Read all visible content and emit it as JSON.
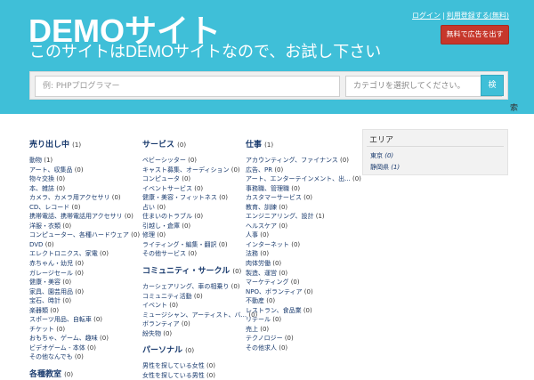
{
  "header": {
    "title": "DEMOサイト",
    "subtitle": "このサイトはDEMOサイトなので、お試し下さい",
    "login_label": "ログイン",
    "register_label": "利用登録する(無料)",
    "separator": "|",
    "ad_button_label": "無料で広告を出す"
  },
  "search": {
    "placeholder": "例: PHPプログラマー",
    "category_placeholder": "カテゴリを選択してください。",
    "button_label": "検"
  },
  "below_glyph": "索",
  "columns": [
    {
      "groups": [
        {
          "title": "売り出し中",
          "count": "(1)",
          "items": [
            {
              "label": "動物",
              "count": "(1)"
            },
            {
              "label": "アート、収集品",
              "count": "(0)"
            },
            {
              "label": "物々交換",
              "count": "(0)"
            },
            {
              "label": "本、雑誌",
              "count": "(0)"
            },
            {
              "label": "カメラ、カメラ用アクセサリ",
              "count": "(0)"
            },
            {
              "label": "CD、レコード",
              "count": "(0)"
            },
            {
              "label": "携帯電話、携帯電話用アクセサリ",
              "count": "(0)"
            },
            {
              "label": "洋服・衣類",
              "count": "(0)"
            },
            {
              "label": "コンピューター、各種ハードウェア",
              "count": "(0)"
            },
            {
              "label": "DVD",
              "count": "(0)"
            },
            {
              "label": "エレクトロニクス、家電",
              "count": "(0)"
            },
            {
              "label": "赤ちゃん・幼児",
              "count": "(0)"
            },
            {
              "label": "ガレージセール",
              "count": "(0)"
            },
            {
              "label": "健康・美容",
              "count": "(0)"
            },
            {
              "label": "家具、園芸用品",
              "count": "(0)"
            },
            {
              "label": "宝石、時計",
              "count": "(0)"
            },
            {
              "label": "楽器類",
              "count": "(0)"
            },
            {
              "label": "スポーツ用品、自転車",
              "count": "(0)"
            },
            {
              "label": "チケット",
              "count": "(0)"
            },
            {
              "label": "おもちゃ、ゲーム、趣味",
              "count": "(0)"
            },
            {
              "label": "ビデオゲーム - 本体",
              "count": "(0)"
            },
            {
              "label": "その他なんでも",
              "count": "(0)"
            }
          ]
        },
        {
          "title": "各種教室",
          "count": "(0)",
          "items": []
        }
      ]
    },
    {
      "groups": [
        {
          "title": "サービス",
          "count": "(0)",
          "items": [
            {
              "label": "ベビーシッター",
              "count": "(0)"
            },
            {
              "label": "キャスト募集、オーディション",
              "count": "(0)"
            },
            {
              "label": "コンピュータ",
              "count": "(0)"
            },
            {
              "label": "イベントサービス",
              "count": "(0)"
            },
            {
              "label": "健康・美容・フィットネス",
              "count": "(0)"
            },
            {
              "label": "占い",
              "count": "(0)"
            },
            {
              "label": "住まいのトラブル",
              "count": "(0)"
            },
            {
              "label": "引越し・倉庫",
              "count": "(0)"
            },
            {
              "label": "修理",
              "count": "(0)"
            },
            {
              "label": "ライティング・編集・翻訳",
              "count": "(0)"
            },
            {
              "label": "その他サービス",
              "count": "(0)"
            }
          ]
        },
        {
          "title": "コミュニティ・サークル",
          "count": "(0)",
          "items": [
            {
              "label": "カーシェアリング、車の相乗り",
              "count": "(0)"
            },
            {
              "label": "コミュニティ活動",
              "count": "(0)"
            },
            {
              "label": "イベント",
              "count": "(0)"
            },
            {
              "label": "ミュージシャン、アーティスト、バ...",
              "count": "(0)"
            },
            {
              "label": "ボランティア",
              "count": "(0)"
            },
            {
              "label": "紛失物",
              "count": "(0)"
            }
          ]
        },
        {
          "title": "パーソナル",
          "count": "(0)",
          "items": [
            {
              "label": "男性を探している女性",
              "count": "(0)"
            },
            {
              "label": "女性を探している男性",
              "count": "(0)"
            }
          ]
        }
      ]
    },
    {
      "groups": [
        {
          "title": "仕事",
          "count": "(1)",
          "items": [
            {
              "label": "アカウンティング、ファイナンス",
              "count": "(0)"
            },
            {
              "label": "広告、PR",
              "count": "(0)"
            },
            {
              "label": "アート、エンターテインメント、出...",
              "count": "(0)"
            },
            {
              "label": "事務職、管理職",
              "count": "(0)"
            },
            {
              "label": "カスタマーサービス",
              "count": "(0)"
            },
            {
              "label": "教育、訓練",
              "count": "(0)"
            },
            {
              "label": "エンジニアリング、設計",
              "count": "(1)"
            },
            {
              "label": "ヘルスケア",
              "count": "(0)"
            },
            {
              "label": "人事",
              "count": "(0)"
            },
            {
              "label": "インターネット",
              "count": "(0)"
            },
            {
              "label": "法務",
              "count": "(0)"
            },
            {
              "label": "肉体労働",
              "count": "(0)"
            },
            {
              "label": "製造、運営",
              "count": "(0)"
            },
            {
              "label": "マーケティング",
              "count": "(0)"
            },
            {
              "label": "NPO、ボランティア",
              "count": "(0)"
            },
            {
              "label": "不動産",
              "count": "(0)"
            },
            {
              "label": "レストラン、食品業",
              "count": "(0)"
            },
            {
              "label": "リテール",
              "count": "(0)"
            },
            {
              "label": "売上",
              "count": "(0)"
            },
            {
              "label": "テクノロジー",
              "count": "(0)"
            },
            {
              "label": "その他求人",
              "count": "(0)"
            }
          ]
        }
      ]
    }
  ],
  "area": {
    "title": "エリア",
    "items": [
      {
        "label": "東京",
        "count": "(0)"
      },
      {
        "label": "静岡県",
        "count": "(1)"
      }
    ]
  },
  "colors": {
    "header_bg": "#3fbfd8",
    "ad_button_bg": "#c6372b",
    "link": "#1a3b6e"
  }
}
